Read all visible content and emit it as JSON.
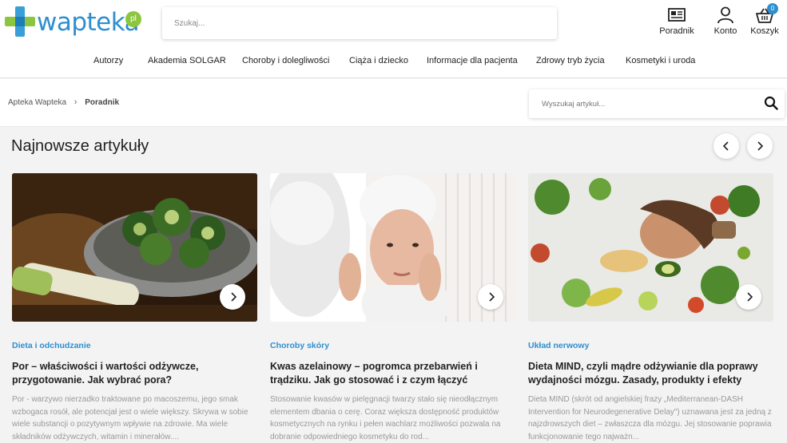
{
  "brand": {
    "logo_text": "wapteka",
    "logo_suffix": "pl"
  },
  "header": {
    "search_placeholder": "Szukaj...",
    "actions": [
      {
        "label": "Poradnik",
        "icon": "newspaper-icon"
      },
      {
        "label": "Konto",
        "icon": "user-icon"
      },
      {
        "label": "Koszyk",
        "icon": "basket-icon",
        "badge": "0"
      }
    ]
  },
  "nav": {
    "items": [
      {
        "label": "Autorzy"
      },
      {
        "label": "Akademia SOLGAR"
      },
      {
        "label": "Choroby i dolegliwości"
      },
      {
        "label": "Ciąża i dziecko"
      },
      {
        "label": "Informacje dla pacjenta"
      },
      {
        "label": "Zdrowy tryb życia"
      },
      {
        "label": "Kosmetyki i uroda"
      }
    ]
  },
  "breadcrumb": {
    "home": "Apteka Wapteka",
    "current": "Poradnik"
  },
  "article_search": {
    "placeholder": "Wyszukaj artykuł..."
  },
  "section": {
    "title": "Najnowsze artykuły"
  },
  "articles": [
    {
      "category": "Dieta i odchudzanie",
      "title": "Por – właściwości i wartości odżywcze, przygotowanie. Jak wybrać pora?",
      "excerpt": "Por - warzywo nierzadko traktowane po macoszemu, jego smak wzbogaca rosół, ale potencjał jest o wiele większy. Skrywa w sobie wiele substancji o pozytywnym wpływie na zdrowie. Ma wiele składników odżywczych, witamin i minerałów...."
    },
    {
      "category": "Choroby skóry",
      "title": "Kwas azelainowy – pogromca przebarwień i trądziku. Jak go stosować i z czym łączyć",
      "excerpt": "Stosowanie kwasów w pielęgnacji twarzy stało się nieodłącznym elementem dbania o cerę. Coraz większa dostępność produktów kosmetycznych na rynku i pełen wachlarz możliwości pozwala na dobranie odpowiedniego kosmetyku do rod..."
    },
    {
      "category": "Układ nerwowy",
      "title": "Dieta MIND, czyli mądre odżywianie dla poprawy wydajności mózgu. Zasady, produkty i efekty",
      "excerpt": "Dieta MIND (skrót od angielskiej frazy „Mediterranean-DASH Intervention for Neurodegenerative Delay\") uznawana jest za jedną z najzdrowszych diet – zwłaszcza dla mózgu. Jej stosowanie poprawia funkcjonowanie tego najważn..."
    }
  ],
  "colors": {
    "accent": "#2d8fcf",
    "brand_green": "#8cc63f"
  }
}
